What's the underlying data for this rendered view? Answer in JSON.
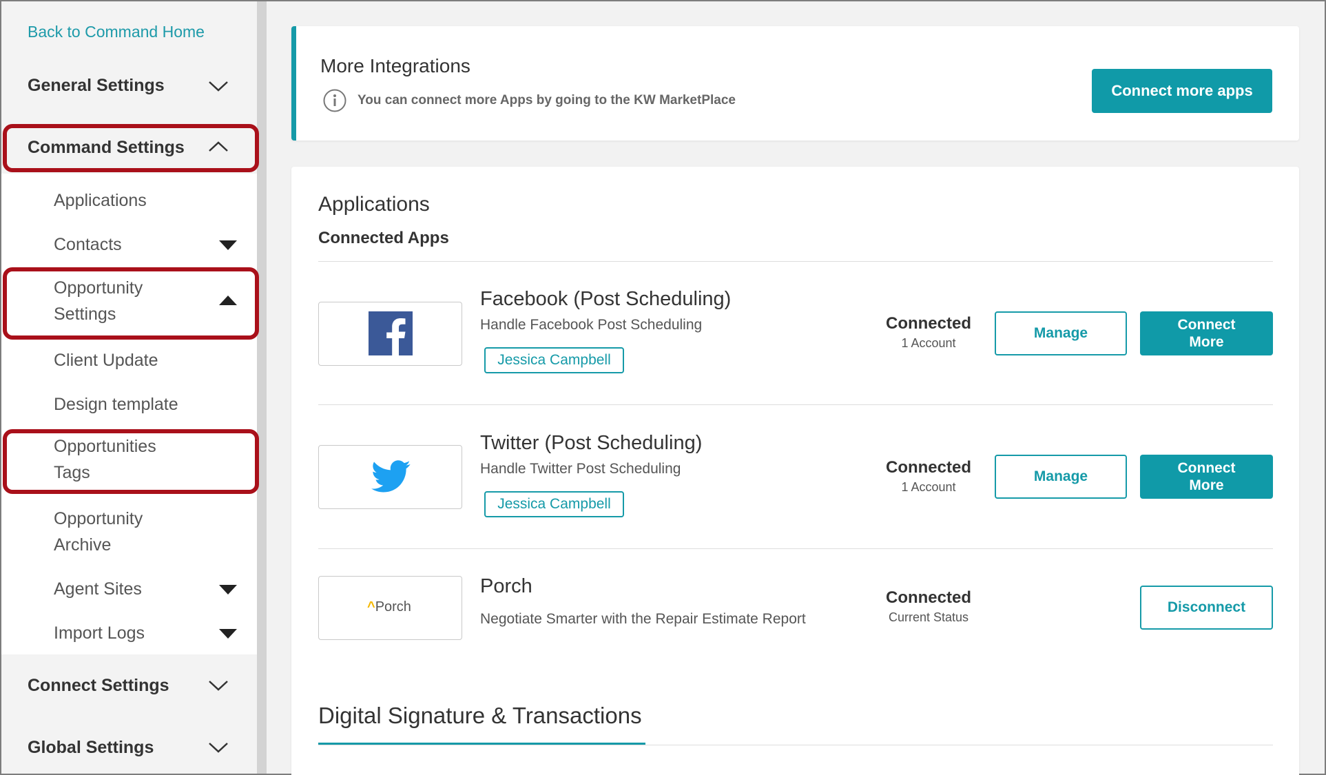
{
  "sidebar": {
    "back_link": "Back to Command Home",
    "general_settings": "General Settings",
    "command_settings": "Command Settings",
    "items": {
      "applications": "Applications",
      "contacts": "Contacts",
      "opportunity_settings_1": "Opportunity",
      "opportunity_settings_2": "Settings",
      "client_update": "Client Update",
      "design_template": "Design template",
      "opportunities_tags_1": "Opportunities",
      "opportunities_tags_2": "Tags",
      "opportunity_archive_1": "Opportunity",
      "opportunity_archive_2": "Archive",
      "agent_sites": "Agent Sites",
      "import_logs": "Import Logs"
    },
    "connect_settings": "Connect Settings",
    "global_settings": "Global Settings"
  },
  "integrations": {
    "title": "More Integrations",
    "info_text": "You can connect more Apps by going to the KW MarketPlace",
    "button": "Connect more apps"
  },
  "applications": {
    "title": "Applications",
    "connected_title": "Connected Apps",
    "apps": [
      {
        "name": "Facebook (Post Scheduling)",
        "desc": "Handle Facebook Post Scheduling",
        "tag": "Jessica Campbell",
        "status": "Connected",
        "status_sub": "1 Account",
        "manage": "Manage",
        "connect_1": "Connect",
        "connect_2": "More"
      },
      {
        "name": "Twitter (Post Scheduling)",
        "desc": "Handle Twitter Post Scheduling",
        "tag": "Jessica Campbell",
        "status": "Connected",
        "status_sub": "1 Account",
        "manage": "Manage",
        "connect_1": "Connect",
        "connect_2": "More"
      },
      {
        "name": "Porch",
        "logo_text": "Porch",
        "desc": "Negotiate Smarter with the Repair Estimate Report",
        "status": "Connected",
        "status_sub": "Current Status",
        "disconnect": "Disconnect"
      }
    ],
    "digital_signature_title": "Digital Signature & Transactions"
  },
  "colors": {
    "accent": "#159aa8",
    "highlight": "#a9101a",
    "facebook": "#3b5998",
    "twitter": "#1da1f2",
    "porch_accent": "#f5b800"
  }
}
